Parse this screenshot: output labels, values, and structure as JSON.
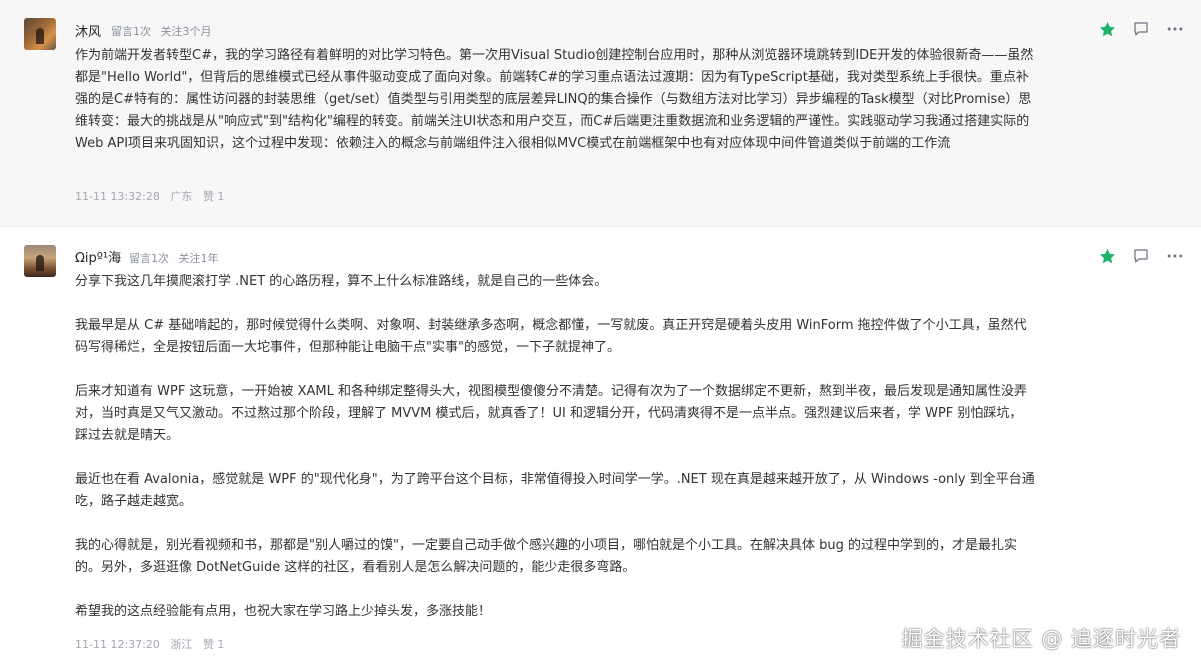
{
  "comments": [
    {
      "author": "沐风",
      "comment_count": "留言1次",
      "follow_duration": "关注3个月",
      "content": [
        "作为前端开发者转型C#，我的学习路径有着鲜明的对比学习特色。第一次用Visual Studio创建控制台应用时，那种从浏览器环境跳转到IDE开发的体验很新奇——虽然都是\"Hello World\"，但背后的思维模式已经从事件驱动变成了面向对象。前端转C#的学习重点语法过渡期：因为有TypeScript基础，我对类型系统上手很快。重点补强的是C#特有的：属性访问器的封装思维（get/set）值类型与引用类型的底层差异LINQ的集合操作（与数组方法对比学习）异步编程的Task模型（对比Promise）思维转变：最大的挑战是从\"响应式\"到\"结构化\"编程的转变。前端关注UI状态和用户交互，而C#后端更注重数据流和业务逻辑的严谨性。实践驱动学习我通过搭建实际的Web API项目来巩固知识，这个过程中发现：依赖注入的概念与前端组件注入很相似MVC模式在前端框架中也有对应体现中间件管道类似于前端的工作流"
      ],
      "time": "11-11 13:32:28",
      "location": "广东",
      "likes": "赞 1"
    },
    {
      "author": "Ωipº¹海",
      "comment_count": "留言1次",
      "follow_duration": "关注1年",
      "content": [
        "分享下我这几年摸爬滚打学 .NET 的心路历程，算不上什么标准路线，就是自己的一些体会。",
        "我最早是从 C# 基础啃起的，那时候觉得什么类啊、对象啊、封装继承多态啊，概念都懂，一写就废。真正开窍是硬着头皮用 WinForm 拖控件做了个小工具，虽然代码写得稀烂，全是按钮后面一大坨事件，但那种能让电脑干点\"实事\"的感觉，一下子就提神了。",
        "后来才知道有 WPF 这玩意，一开始被 XAML 和各种绑定整得头大，视图模型傻傻分不清楚。记得有次为了一个数据绑定不更新，熬到半夜，最后发现是通知属性没弄对，当时真是又气又激动。不过熬过那个阶段，理解了 MVVM 模式后，就真香了！UI 和逻辑分开，代码清爽得不是一点半点。强烈建议后来者，学 WPF 别怕踩坑，踩过去就是晴天。",
        "最近也在看 Avalonia，感觉就是 WPF 的\"现代化身\"，为了跨平台这个目标，非常值得投入时间学一学。.NET 现在真是越来越开放了，从 Windows -only 到全平台通吃，路子越走越宽。",
        "我的心得就是，别光看视频和书，那都是\"别人嚼过的馍\"，一定要自己动手做个感兴趣的小项目，哪怕就是个小工具。在解决具体 bug 的过程中学到的，才是最扎实的。另外，多逛逛像 DotNetGuide 这样的社区，看看别人是怎么解决问题的，能少走很多弯路。",
        "希望我的这点经验能有点用，也祝大家在学习路上少掉头发，多涨技能！"
      ],
      "time": "11-11 12:37:20",
      "location": "浙江",
      "likes": "赞 1"
    }
  ],
  "icons": {
    "favorite": "star-icon",
    "reply": "reply-bubble-icon",
    "more": "more-dots-icon"
  },
  "colors": {
    "star": "#1fb36b",
    "meta": "#8a919f",
    "text": "#333333"
  },
  "watermark": "掘金技术社区 @ 追逐时光者"
}
